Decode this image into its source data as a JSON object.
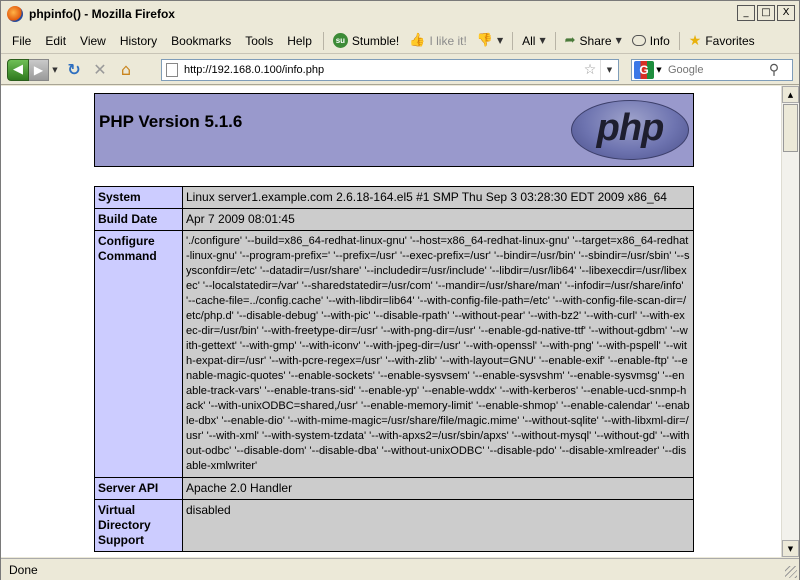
{
  "window": {
    "title": "phpinfo() - Mozilla Firefox",
    "controls": {
      "minimize": "_",
      "maximize": "□",
      "close": "X"
    }
  },
  "menubar": {
    "items": [
      {
        "label": "File"
      },
      {
        "label": "Edit"
      },
      {
        "label": "View"
      },
      {
        "label": "History"
      },
      {
        "label": "Bookmarks"
      },
      {
        "label": "Tools"
      },
      {
        "label": "Help"
      }
    ],
    "toolbar": {
      "stumble": "Stumble!",
      "like": "I like it!",
      "all": "All",
      "share": "Share",
      "info": "Info",
      "favorites": "Favorites"
    }
  },
  "navbar": {
    "url": "http://192.168.0.100/info.php",
    "search_placeholder": "Google",
    "search_engine": "G"
  },
  "page": {
    "php_version": "PHP Version 5.1.6",
    "logo_text": "php",
    "rows": [
      {
        "key": "System",
        "value": "Linux server1.example.com 2.6.18-164.el5 #1 SMP Thu Sep 3 03:28:30 EDT 2009 x86_64"
      },
      {
        "key": "Build Date",
        "value": "Apr 7 2009 08:01:45"
      },
      {
        "key": "Configure Command",
        "value": "'./configure' '--build=x86_64-redhat-linux-gnu' '--host=x86_64-redhat-linux-gnu' '--target=x86_64-redhat-linux-gnu' '--program-prefix=' '--prefix=/usr' '--exec-prefix=/usr' '--bindir=/usr/bin' '--sbindir=/usr/sbin' '--sysconfdir=/etc' '--datadir=/usr/share' '--includedir=/usr/include' '--libdir=/usr/lib64' '--libexecdir=/usr/libexec' '--localstatedir=/var' '--sharedstatedir=/usr/com' '--mandir=/usr/share/man' '--infodir=/usr/share/info' '--cache-file=../config.cache' '--with-libdir=lib64' '--with-config-file-path=/etc' '--with-config-file-scan-dir=/etc/php.d' '--disable-debug' '--with-pic' '--disable-rpath' '--without-pear' '--with-bz2' '--with-curl' '--with-exec-dir=/usr/bin' '--with-freetype-dir=/usr' '--with-png-dir=/usr' '--enable-gd-native-ttf' '--without-gdbm' '--with-gettext' '--with-gmp' '--with-iconv' '--with-jpeg-dir=/usr' '--with-openssl' '--with-png' '--with-pspell' '--with-expat-dir=/usr' '--with-pcre-regex=/usr' '--with-zlib' '--with-layout=GNU' '--enable-exif' '--enable-ftp' '--enable-magic-quotes' '--enable-sockets' '--enable-sysvsem' '--enable-sysvshm' '--enable-sysvmsg' '--enable-track-vars' '--enable-trans-sid' '--enable-yp' '--enable-wddx' '--with-kerberos' '--enable-ucd-snmp-hack' '--with-unixODBC=shared,/usr' '--enable-memory-limit' '--enable-shmop' '--enable-calendar' '--enable-dbx' '--enable-dio' '--with-mime-magic=/usr/share/file/magic.mime' '--without-sqlite' '--with-libxml-dir=/usr' '--with-xml' '--with-system-tzdata' '--with-apxs2=/usr/sbin/apxs' '--without-mysql' '--without-gd' '--without-odbc' '--disable-dom' '--disable-dba' '--without-unixODBC' '--disable-pdo' '--disable-xmlreader' '--disable-xmlwriter'"
      },
      {
        "key": "Server API",
        "value": "Apache 2.0 Handler"
      },
      {
        "key": "Virtual Directory Support",
        "value": "disabled"
      }
    ]
  },
  "statusbar": {
    "text": "Done"
  },
  "colors": {
    "header_bg": "#9999cc",
    "key_bg": "#ccccff",
    "value_bg": "#cccccc"
  }
}
